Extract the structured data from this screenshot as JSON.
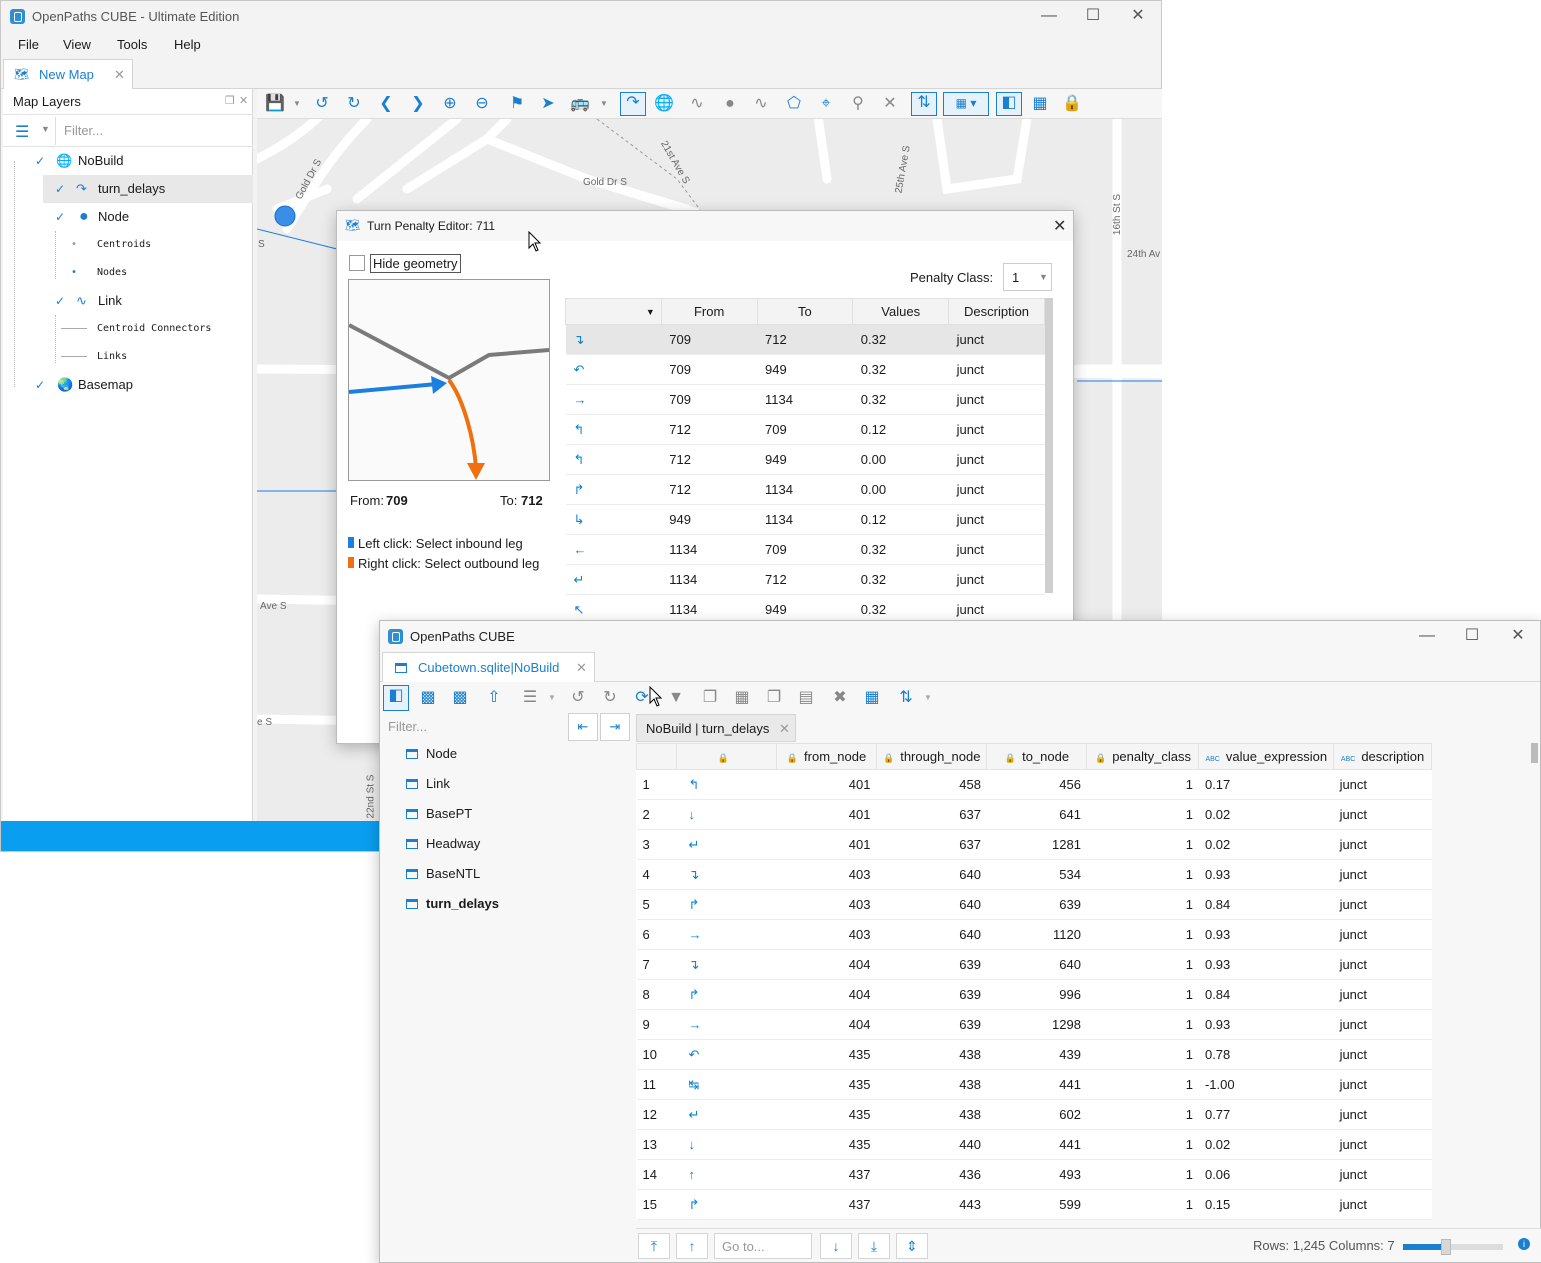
{
  "main_window": {
    "title": "OpenPaths CUBE - Ultimate Edition",
    "menu": [
      "File",
      "View",
      "Tools",
      "Help"
    ],
    "tab_label": "New Map",
    "layers_panel_title": "Map Layers",
    "filter_placeholder": "Filter...",
    "layers": [
      {
        "label": "NoBuild",
        "checked": true,
        "icon": "globe-icon"
      },
      {
        "label": "turn_delays",
        "checked": true,
        "icon": "turn-arrow-icon"
      },
      {
        "label": "Node",
        "checked": true,
        "icon": "dot-icon"
      },
      {
        "label": "Centroids",
        "icon": "small-dot-icon"
      },
      {
        "label": "Nodes",
        "icon": "small-dot-icon"
      },
      {
        "label": "Link",
        "checked": true,
        "icon": "wave-icon"
      },
      {
        "label": "Centroid Connectors",
        "icon": "line-icon"
      },
      {
        "label": "Links",
        "icon": "line-icon"
      },
      {
        "label": "Basemap",
        "checked": true,
        "icon": "earth-icon"
      }
    ],
    "street_labels": [
      "Gold Dr S",
      "Gold Dr S",
      "21st Ave S",
      "25th Ave S",
      "16th St S",
      "24th Av",
      "Ave S",
      "e S",
      "22nd St S",
      "S"
    ]
  },
  "turn_dialog": {
    "title": "Turn Penalty Editor: 711",
    "hide_geometry_label": "Hide geometry",
    "penalty_class_label": "Penalty Class:",
    "penalty_class_value": "1",
    "from_label": "From:",
    "from_value": "709",
    "to_label": "To:",
    "to_value": "712",
    "legend_left": "Left click: Select inbound leg",
    "legend_right": "Right click: Select outbound leg",
    "colors": {
      "inbound": "#1a7fe0",
      "outbound": "#f07010",
      "road": "#7a7a7a"
    },
    "columns": [
      "",
      "From",
      "To",
      "Values",
      "Description"
    ],
    "rows": [
      {
        "from": "709",
        "to": "712",
        "value": "0.32",
        "desc": "junct"
      },
      {
        "from": "709",
        "to": "949",
        "value": "0.32",
        "desc": "junct"
      },
      {
        "from": "709",
        "to": "1134",
        "value": "0.32",
        "desc": "junct"
      },
      {
        "from": "712",
        "to": "709",
        "value": "0.12",
        "desc": "junct"
      },
      {
        "from": "712",
        "to": "949",
        "value": "0.00",
        "desc": "junct"
      },
      {
        "from": "712",
        "to": "1134",
        "value": "0.00",
        "desc": "junct"
      },
      {
        "from": "949",
        "to": "1134",
        "value": "0.12",
        "desc": "junct"
      },
      {
        "from": "1134",
        "to": "709",
        "value": "0.32",
        "desc": "junct"
      },
      {
        "from": "1134",
        "to": "712",
        "value": "0.32",
        "desc": "junct"
      },
      {
        "from": "1134",
        "to": "949",
        "value": "0.32",
        "desc": "junct"
      }
    ]
  },
  "data_window": {
    "title": "OpenPaths CUBE",
    "tab_label": "Cubetown.sqlite|NoBuild",
    "filter_placeholder": "Filter...",
    "inner_tab_label": "NoBuild | turn_delays",
    "tables": [
      "Node",
      "Link",
      "BasePT",
      "Headway",
      "BaseNTL",
      "turn_delays"
    ],
    "columns": [
      "",
      "from_node",
      "through_node",
      "to_node",
      "penalty_class",
      "value_expression",
      "description"
    ],
    "rows": [
      {
        "n": "1",
        "from": "401",
        "through": "458",
        "to": "456",
        "pc": "1",
        "val": "0.17",
        "desc": "junct"
      },
      {
        "n": "2",
        "from": "401",
        "through": "637",
        "to": "641",
        "pc": "1",
        "val": "0.02",
        "desc": "junct"
      },
      {
        "n": "3",
        "from": "401",
        "through": "637",
        "to": "1281",
        "pc": "1",
        "val": "0.02",
        "desc": "junct"
      },
      {
        "n": "4",
        "from": "403",
        "through": "640",
        "to": "534",
        "pc": "1",
        "val": "0.93",
        "desc": "junct"
      },
      {
        "n": "5",
        "from": "403",
        "through": "640",
        "to": "639",
        "pc": "1",
        "val": "0.84",
        "desc": "junct"
      },
      {
        "n": "6",
        "from": "403",
        "through": "640",
        "to": "1120",
        "pc": "1",
        "val": "0.93",
        "desc": "junct"
      },
      {
        "n": "7",
        "from": "404",
        "through": "639",
        "to": "640",
        "pc": "1",
        "val": "0.93",
        "desc": "junct"
      },
      {
        "n": "8",
        "from": "404",
        "through": "639",
        "to": "996",
        "pc": "1",
        "val": "0.84",
        "desc": "junct"
      },
      {
        "n": "9",
        "from": "404",
        "through": "639",
        "to": "1298",
        "pc": "1",
        "val": "0.93",
        "desc": "junct"
      },
      {
        "n": "10",
        "from": "435",
        "through": "438",
        "to": "439",
        "pc": "1",
        "val": "0.78",
        "desc": "junct"
      },
      {
        "n": "11",
        "from": "435",
        "through": "438",
        "to": "441",
        "pc": "1",
        "val": "-1.00",
        "desc": "junct"
      },
      {
        "n": "12",
        "from": "435",
        "through": "438",
        "to": "602",
        "pc": "1",
        "val": "0.77",
        "desc": "junct"
      },
      {
        "n": "13",
        "from": "435",
        "through": "440",
        "to": "441",
        "pc": "1",
        "val": "0.02",
        "desc": "junct"
      },
      {
        "n": "14",
        "from": "437",
        "through": "436",
        "to": "493",
        "pc": "1",
        "val": "0.06",
        "desc": "junct"
      },
      {
        "n": "15",
        "from": "437",
        "through": "443",
        "to": "599",
        "pc": "1",
        "val": "0.15",
        "desc": "junct"
      }
    ],
    "goto_placeholder": "Go to...",
    "status": "Rows: 1,245 Columns: 7"
  }
}
